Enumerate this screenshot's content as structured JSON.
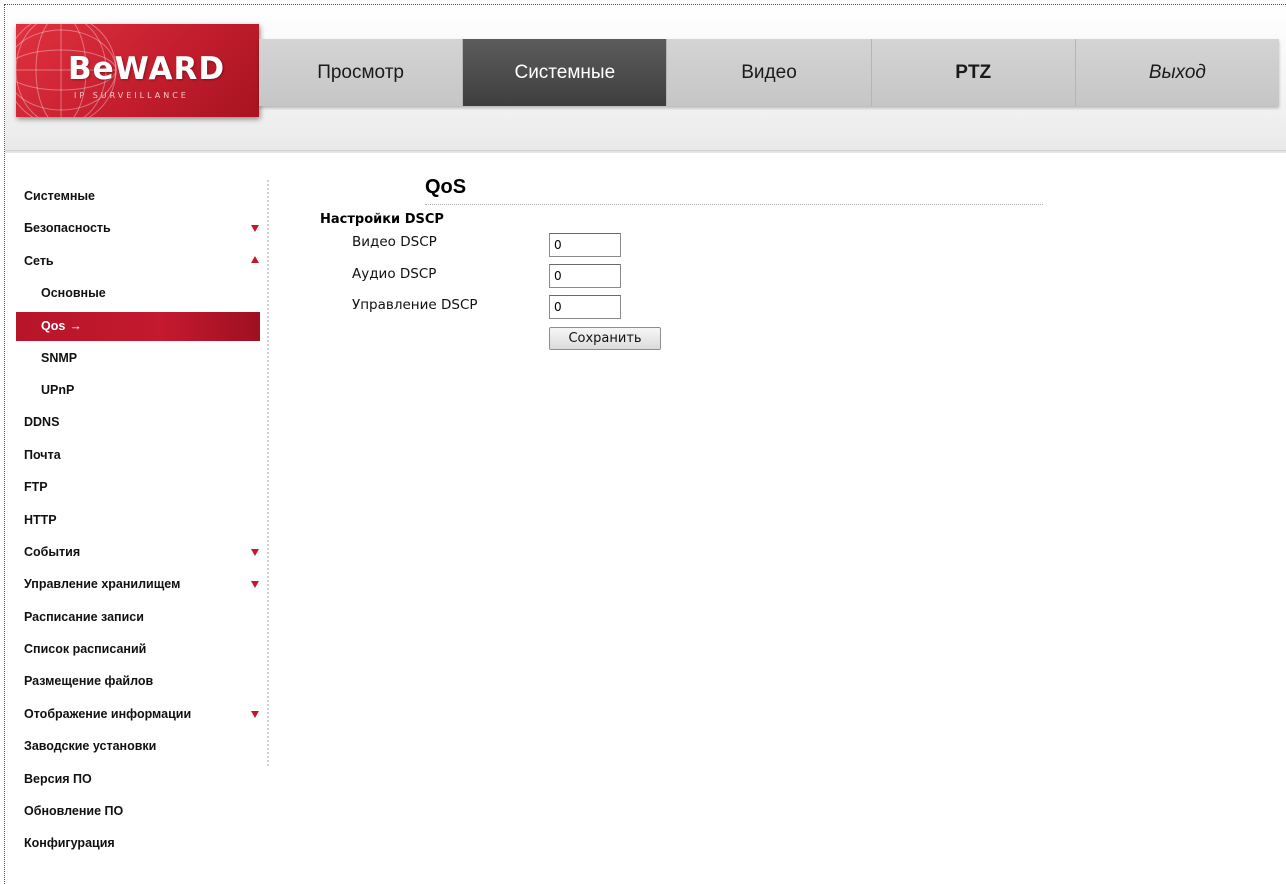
{
  "brand": {
    "logo_text": "BeWARD",
    "logo_subtext": "IP SURVEILLANCE"
  },
  "nav": {
    "items": [
      {
        "label": "Просмотр",
        "active": false
      },
      {
        "label": "Системные",
        "active": true
      },
      {
        "label": "Видео",
        "active": false
      },
      {
        "label": "PTZ",
        "active": false
      },
      {
        "label": "Выход",
        "active": false
      }
    ]
  },
  "sidebar": {
    "items": [
      {
        "label": "Системные"
      },
      {
        "label": "Безопасность",
        "caret": "down"
      },
      {
        "label": "Сеть",
        "caret": "up"
      },
      {
        "label": "Основные"
      },
      {
        "label": "Qos",
        "active": true,
        "icon": "right-arrow-icon",
        "icon_glyph": "→"
      },
      {
        "label": "SNMP"
      },
      {
        "label": "UPnP"
      },
      {
        "label": "DDNS"
      },
      {
        "label": "Почта"
      },
      {
        "label": "FTP"
      },
      {
        "label": "HTTP"
      },
      {
        "label": "События",
        "caret": "down"
      },
      {
        "label": "Управление хранилищем",
        "caret": "down"
      },
      {
        "label": "Расписание записи"
      },
      {
        "label": "Список расписаний"
      },
      {
        "label": "Размещение файлов"
      },
      {
        "label": "Отображение информации",
        "caret": "down"
      },
      {
        "label": "Заводские установки"
      },
      {
        "label": "Версия ПО"
      },
      {
        "label": "Обновление ПО"
      },
      {
        "label": "Конфигурация"
      }
    ]
  },
  "main": {
    "title": "QoS",
    "section_title": "Настройки DSCP",
    "fields": [
      {
        "label": "Видео DSCP",
        "value": "0"
      },
      {
        "label": "Аудио DSCP",
        "value": "0"
      },
      {
        "label": "Управление DSCP",
        "value": "0"
      }
    ],
    "save_label": "Сохранить"
  },
  "colors": {
    "accent_red": "#c41e2e",
    "nav_active": "#4a4a4a",
    "nav_inactive": "#cccccc"
  }
}
